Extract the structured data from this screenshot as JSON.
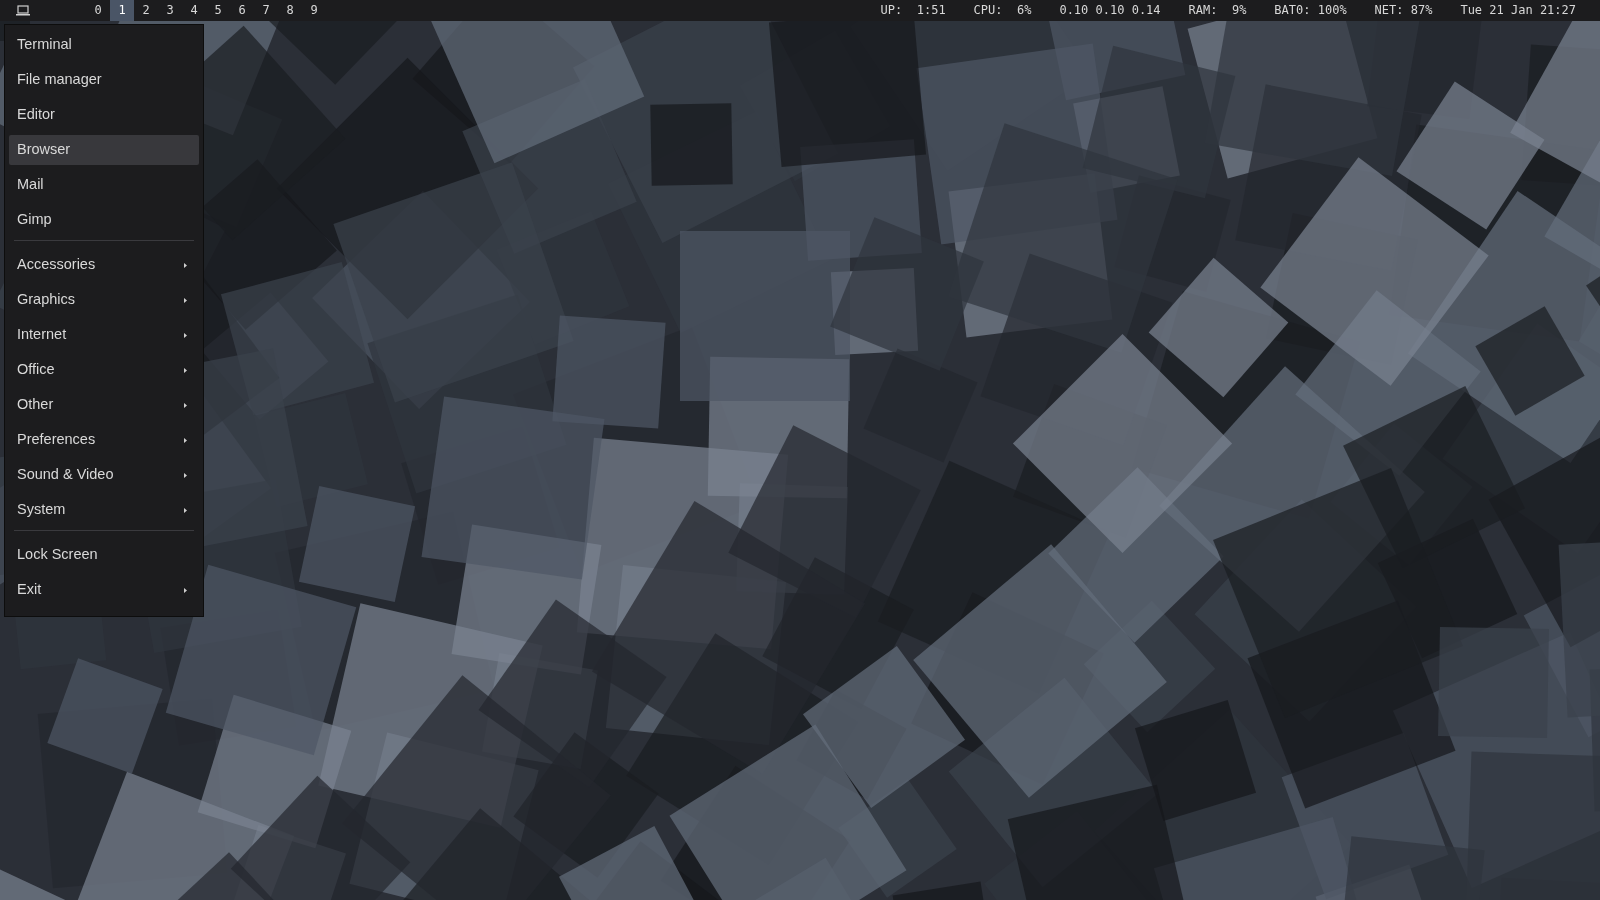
{
  "top_bar": {
    "workspaces": [
      {
        "label": "0",
        "selected": false
      },
      {
        "label": "1",
        "selected": true
      },
      {
        "label": "2",
        "selected": false
      },
      {
        "label": "3",
        "selected": false
      },
      {
        "label": "4",
        "selected": false
      },
      {
        "label": "5",
        "selected": false
      },
      {
        "label": "6",
        "selected": false
      },
      {
        "label": "7",
        "selected": false
      },
      {
        "label": "8",
        "selected": false
      },
      {
        "label": "9",
        "selected": false
      }
    ],
    "status": [
      "UP:  1:51",
      "CPU:  6%",
      "0.10 0.10 0.14",
      "RAM:  9%",
      "BAT0: 100%",
      "NET: 87%",
      "Tue 21 Jan 21:27"
    ]
  },
  "menu": {
    "items": [
      {
        "kind": "item",
        "label": "Terminal",
        "selected": false
      },
      {
        "kind": "item",
        "label": "File manager",
        "selected": false
      },
      {
        "kind": "item",
        "label": "Editor",
        "selected": false
      },
      {
        "kind": "item",
        "label": "Browser",
        "selected": true
      },
      {
        "kind": "item",
        "label": "Mail",
        "selected": false
      },
      {
        "kind": "item",
        "label": "Gimp",
        "selected": false
      },
      {
        "kind": "separator"
      },
      {
        "kind": "submenu",
        "label": "Accessories",
        "selected": false
      },
      {
        "kind": "submenu",
        "label": "Graphics",
        "selected": false
      },
      {
        "kind": "submenu",
        "label": "Internet",
        "selected": false
      },
      {
        "kind": "submenu",
        "label": "Office",
        "selected": false
      },
      {
        "kind": "submenu",
        "label": "Other",
        "selected": false
      },
      {
        "kind": "submenu",
        "label": "Preferences",
        "selected": false
      },
      {
        "kind": "submenu",
        "label": "Sound & Video",
        "selected": false
      },
      {
        "kind": "submenu",
        "label": "System",
        "selected": false
      },
      {
        "kind": "separator"
      },
      {
        "kind": "item",
        "label": "Lock Screen",
        "selected": false
      },
      {
        "kind": "submenu",
        "label": "Exit",
        "selected": false
      }
    ]
  }
}
